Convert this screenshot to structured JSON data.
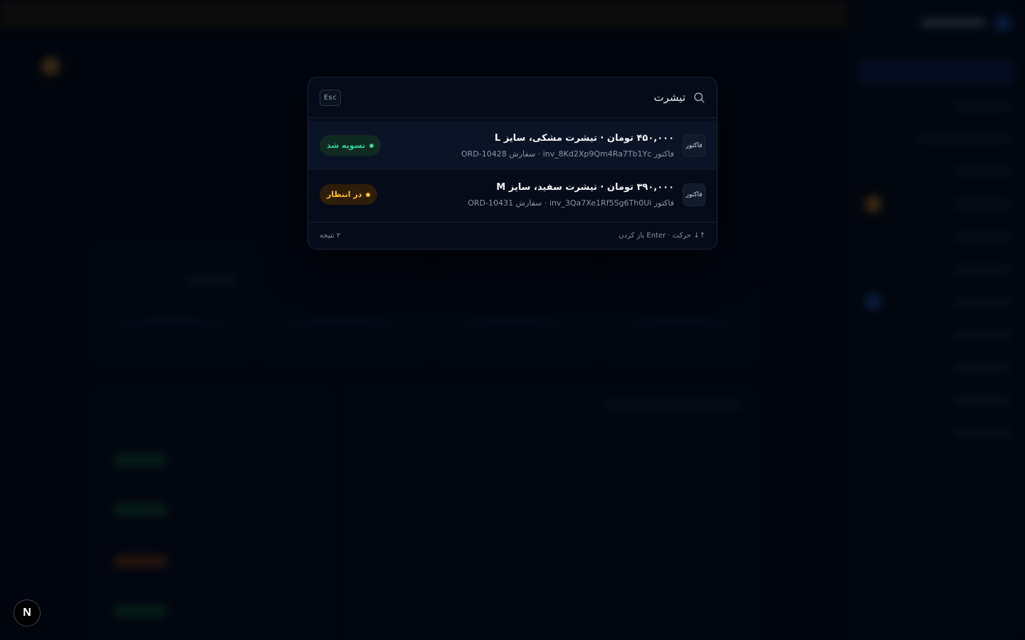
{
  "colors": {
    "background": "#020610",
    "palette_bg": "#050b18",
    "selected_row": "#0b1426",
    "paid": "#34d399",
    "pending": "#fbbf24"
  },
  "palette": {
    "search": {
      "value": "تیشرت",
      "placeholder": ""
    },
    "esc_label": "Esc",
    "results": [
      {
        "type_label": "فاکتور",
        "title": "۴۵۰,۰۰۰ تومان · تیشرت مشکی، سایز L",
        "subtitle": "فاکتور inv_8Kd2Xp9Qm4Ra7Tb1Yc · سفارش ORD-10428",
        "status": "تسویه شد",
        "status_kind": "paid",
        "selected": true
      },
      {
        "type_label": "فاکتور",
        "title": "۳۹۰,۰۰۰ تومان · تیشرت سفید، سایز M",
        "subtitle": "فاکتور inv_3Qa7Xe1Rf5Sg6Th0Ui · سفارش ORD-10431",
        "status": "در انتظار",
        "status_kind": "pending",
        "selected": false
      }
    ],
    "footer": {
      "hint": "↑↓ حرکت · Enter باز کردن",
      "count": "۲ نتیجه"
    }
  },
  "dev_badge": {
    "letter": "N"
  }
}
